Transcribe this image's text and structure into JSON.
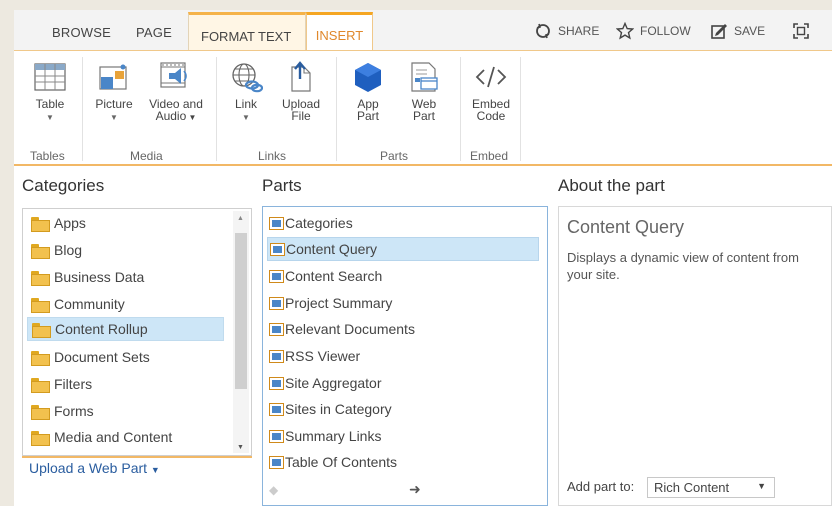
{
  "tabs": {
    "browse": "BROWSE",
    "page": "PAGE",
    "format_text": "FORMAT TEXT",
    "insert": "INSERT"
  },
  "top_actions": {
    "share": "SHARE",
    "follow": "FOLLOW",
    "save": "SAVE"
  },
  "ribbon": {
    "table": "Table",
    "picture": "Picture",
    "video_audio_1": "Video and",
    "video_audio_2": "Audio",
    "link": "Link",
    "upload_file_1": "Upload",
    "upload_file_2": "File",
    "app_part_1": "App",
    "app_part_2": "Part",
    "web_part_1": "Web",
    "web_part_2": "Part",
    "embed_code_1": "Embed",
    "embed_code_2": "Code",
    "groups": {
      "tables": "Tables",
      "media": "Media",
      "links": "Links",
      "parts": "Parts",
      "embed": "Embed"
    }
  },
  "categories": {
    "heading": "Categories",
    "items": [
      "Apps",
      "Blog",
      "Business Data",
      "Community",
      "Content Rollup",
      "Document Sets",
      "Filters",
      "Forms",
      "Media and Content"
    ],
    "selected": "Content Rollup",
    "upload_link": "Upload a Web Part"
  },
  "parts": {
    "heading": "Parts",
    "items": [
      "Categories",
      "Content Query",
      "Content Search",
      "Project Summary",
      "Relevant Documents",
      "RSS Viewer",
      "Site Aggregator",
      "Sites in Category",
      "Summary Links",
      "Table Of Contents"
    ],
    "selected": "Content Query"
  },
  "about": {
    "heading": "About the part",
    "title": "Content Query",
    "description": "Displays a dynamic view of content from your site.",
    "add_part_label": "Add part to:",
    "add_part_value": "Rich Content"
  },
  "colors": {
    "accent_orange": "#f5a623",
    "selection_blue": "#cde6f7",
    "link_blue": "#2a5d9f"
  }
}
